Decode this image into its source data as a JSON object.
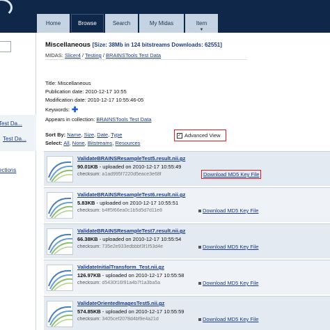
{
  "nav": {
    "tabs": [
      {
        "label": "Home"
      },
      {
        "label": "Browse"
      },
      {
        "label": "Search"
      },
      {
        "label": "My Midas"
      },
      {
        "label": "Item"
      }
    ]
  },
  "sidebar": {
    "links": [
      {
        "label": "Test Da..."
      },
      {
        "label": "Test Da..."
      },
      {
        "label": "ections"
      }
    ]
  },
  "header": {
    "title": "Miscellaneous",
    "subtitle": "[Size: 38Mb in 124 bitstreams Downloads: 62551]",
    "crumb_prefix": "MIDAS:",
    "crumbs": [
      "Slicer4",
      "Testing",
      "BRAINSTools Test Data"
    ]
  },
  "meta": {
    "title": "Title: Miscellaneous",
    "publication": "Publication date: 2010-12-17 10:55",
    "modification": "Modification date: 2010-12-17 10:55:46-05",
    "keywords": "Keywords:",
    "collection_label": "Appears in collection:",
    "collection_value": "BRAINSTools Test Data"
  },
  "controls": {
    "sort_label": "Sort By:",
    "sort_options": [
      "Name",
      "Size",
      "Date",
      "Type"
    ],
    "select_label": "Select:",
    "select_options": [
      "All",
      "None",
      "Bitstreams",
      "Resources"
    ],
    "advanced_view": "Advanced View"
  },
  "items": [
    {
      "name": "ValidateBRAINSResampleTest5.result.nii.gz",
      "size": "90.01KB",
      "uploaded": "uploaded on 2010-12-17 10:55:49",
      "checksum_label": "checksum:",
      "checksum": "a1ad995f7220d5eace3e68f",
      "download": "Download MD5 Key File"
    },
    {
      "name": "ValidateBRAINSResampleTest6.result.nii.gz",
      "size": "5.83KB",
      "uploaded": "uploaded on 2010-12-17 10:55:51",
      "checksum_label": "checksum:",
      "checksum": "b4ff5f66ea0c1b5d5d7d11e8",
      "download": "Download MD5 Key File"
    },
    {
      "name": "ValidateBRAINSResampleTest7.result.nii.gz",
      "size": "66.38KB",
      "uploaded": "uploaded on 2010-12-17 10:55:54",
      "checksum_label": "checksum:",
      "checksum": "735e2e933edbbbf3f1f53d4e",
      "download": "Download MD5 Key File"
    },
    {
      "name": "ValidateInitialTransform_Test.nii.gz",
      "size": "126.97KB",
      "uploaded": "uploaded on 2010-12-17 10:55:58",
      "checksum_label": "checksum:",
      "checksum": "d5430f16f91a4b7f1a3ba5a",
      "download": "Download MD5 Key File"
    },
    {
      "name": "ValidateOrientedImagesTest5.nii.gz",
      "size": "574.85KB",
      "uploaded": "uploaded on 2010-12-17 10:55:59",
      "checksum_label": "checksum:",
      "checksum": "3405cef2078d4bf9e4a21d",
      "download": "Download MD5 Key File"
    }
  ],
  "colors": {
    "topbar": "#0f2748",
    "tab": "#c6d3e2",
    "link": "#1a3a8a",
    "highlight_box": "#d02020"
  }
}
